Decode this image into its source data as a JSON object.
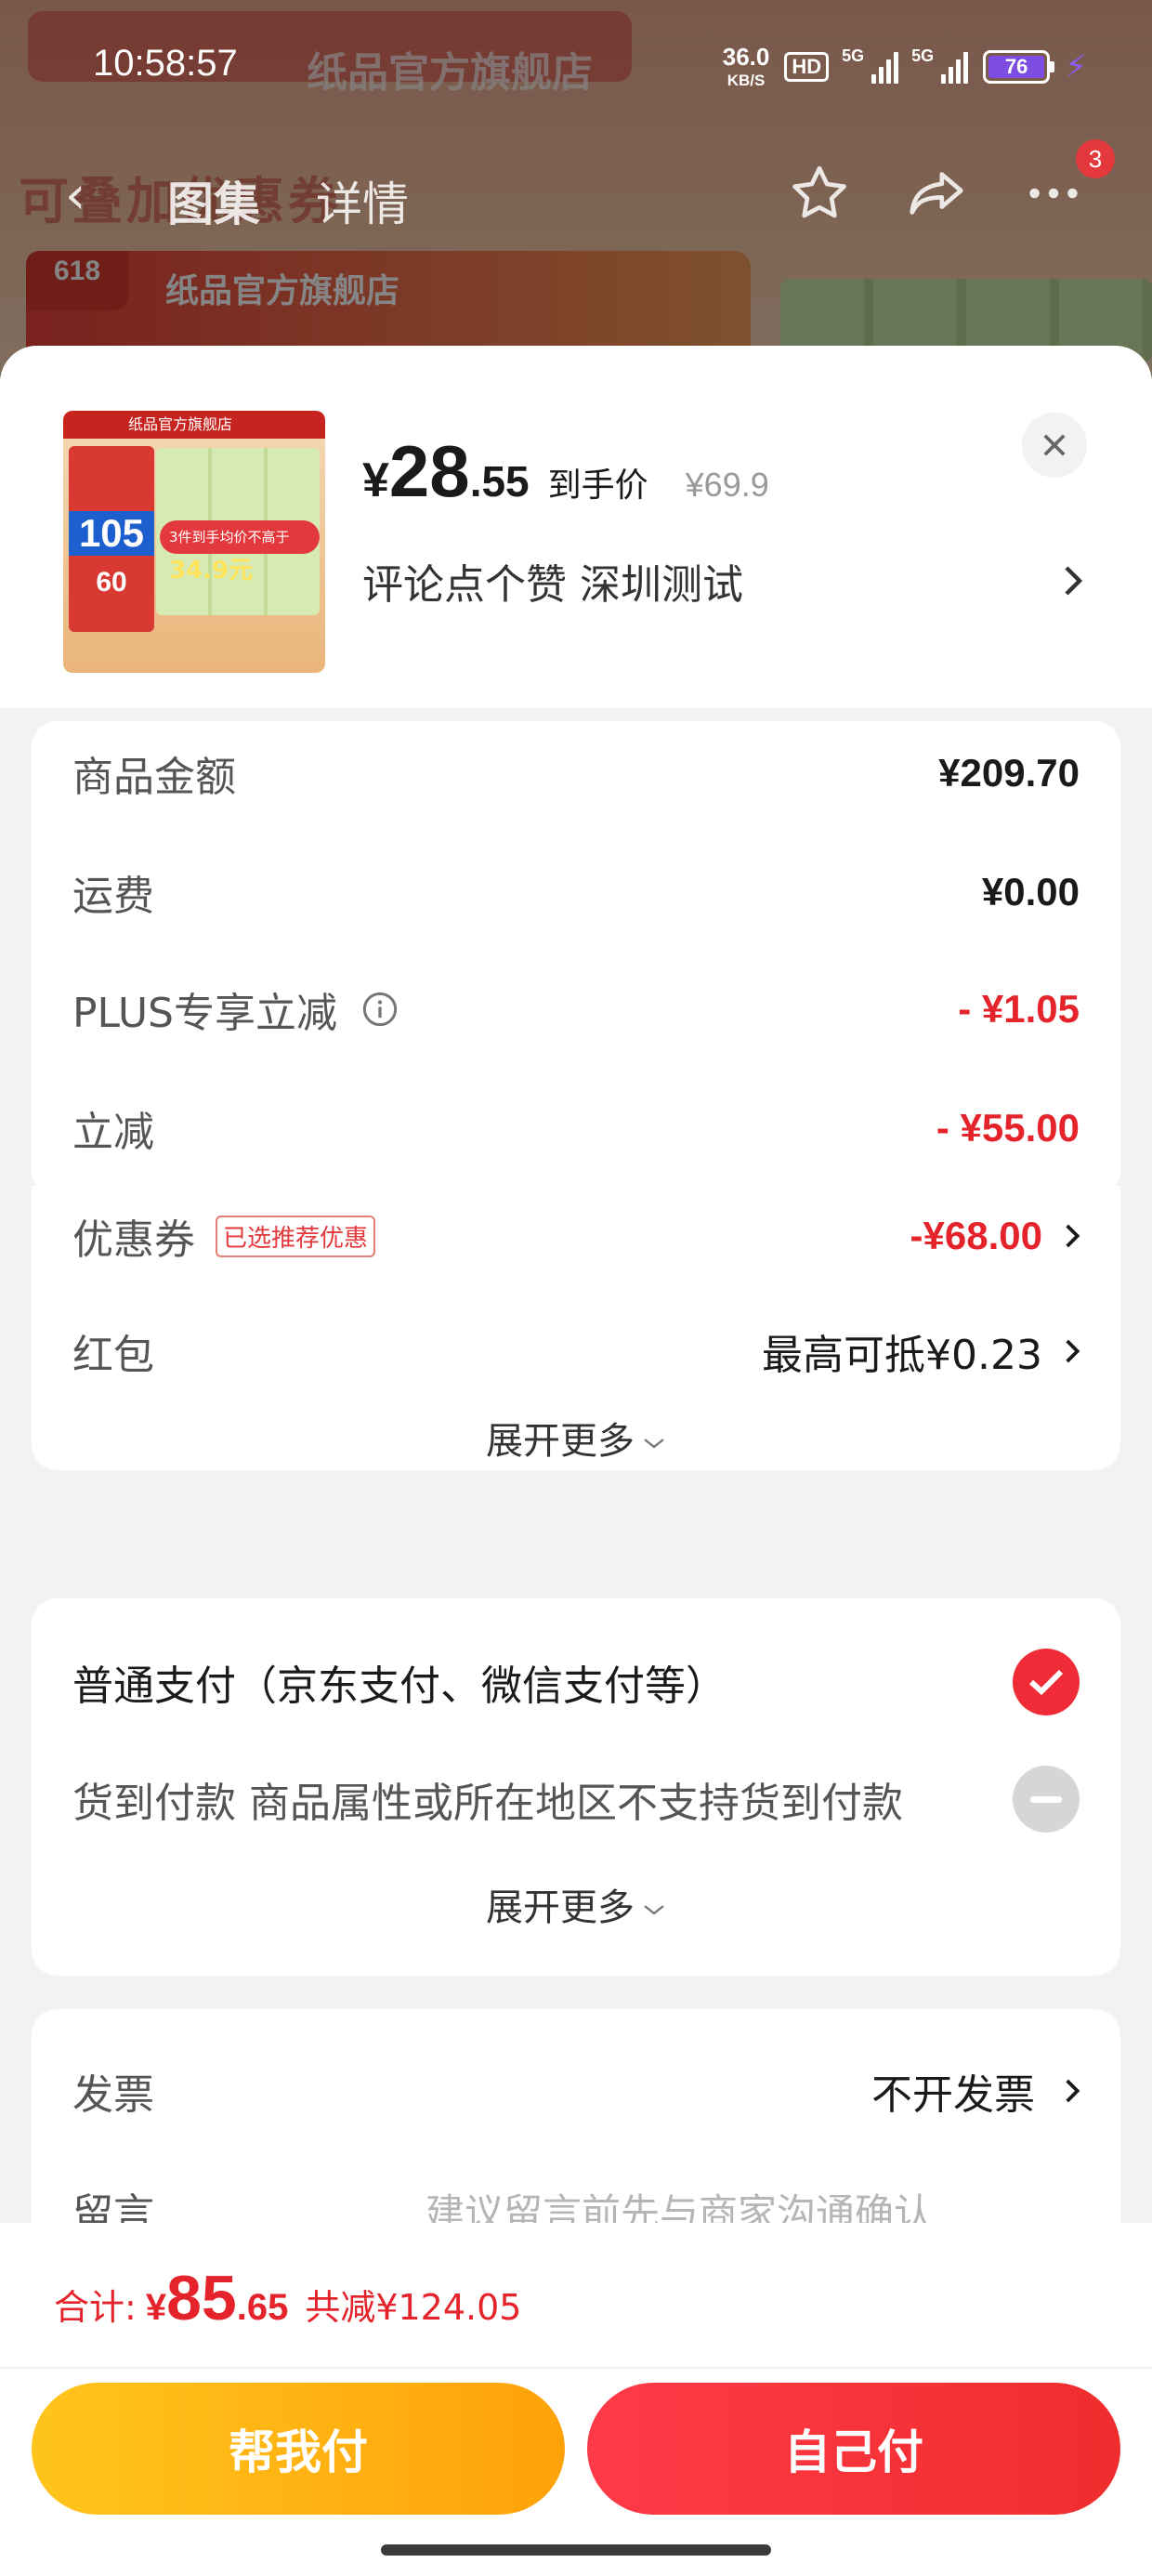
{
  "status_bar": {
    "time": "10:58:57",
    "net_speed_value": "36.0",
    "net_speed_unit": "KB/S",
    "hd_label": "HD",
    "signal_1_label": "5G",
    "signal_2_label": "5G",
    "battery_level": "76"
  },
  "nav": {
    "tabs": [
      {
        "label": "图集",
        "active": true
      },
      {
        "label": "详情",
        "active": false
      }
    ],
    "notification_count": "3"
  },
  "background": {
    "banner_badge": "618",
    "banner_text": "纸品官方旗舰店",
    "deco_text": "可叠加优惠券"
  },
  "product": {
    "thumb_shop": "纸品官方旗舰店",
    "thumb_big_number": "105",
    "thumb_small_number": "60",
    "thumb_pill_text": "3件到手均价不高于",
    "thumb_pill_price": "34.9元",
    "price_currency": "¥",
    "price_integer": "28",
    "price_decimal": ".55",
    "price_label": "到手价",
    "original_price": "¥69.9",
    "spec_text": "评论点个赞  深圳测试"
  },
  "amounts": {
    "rows": [
      {
        "label": "商品金额",
        "value": "¥209.70"
      },
      {
        "label": "运费",
        "value": "¥0.00"
      },
      {
        "label": "PLUS专享立减",
        "value": "- ¥1.05"
      },
      {
        "label": "立减",
        "value": "- ¥55.00"
      },
      {
        "label": "优惠券",
        "tag": "已选推荐优惠",
        "value": "-¥68.00"
      },
      {
        "label": "红包",
        "value": "最高可抵¥0.23"
      }
    ],
    "expand_label": "展开更多"
  },
  "payment": {
    "options": [
      {
        "label": "普通支付（京东支付、微信支付等）",
        "selected": true
      },
      {
        "label": "货到付款 商品属性或所在地区不支持货到付款",
        "selected": false
      }
    ],
    "expand_label": "展开更多"
  },
  "extras": {
    "invoice_label": "发票",
    "invoice_value": "不开发票",
    "message_label": "留言",
    "message_placeholder": "建议留言前先与商家沟通确认"
  },
  "footer": {
    "total_label": "合计:",
    "total_currency": "¥",
    "total_integer": "85",
    "total_decimal": ".65",
    "total_saved": "共减¥124.05",
    "help_pay_label": "帮我付",
    "self_pay_label": "自己付"
  },
  "colors": {
    "accent_red": "#e4232b",
    "help_button": "#ffb014",
    "battery": "#7c4de0"
  }
}
